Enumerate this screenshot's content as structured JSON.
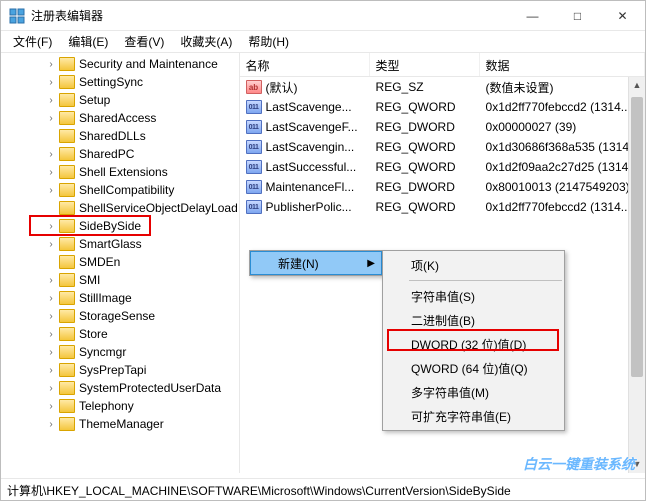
{
  "window": {
    "title": "注册表编辑器",
    "minimize": "—",
    "maximize": "□",
    "close": "✕"
  },
  "menubar": {
    "file": "文件(F)",
    "edit": "编辑(E)",
    "view": "查看(V)",
    "favorites": "收藏夹(A)",
    "help": "帮助(H)"
  },
  "tree": {
    "items": [
      {
        "label": "Security and Maintenance",
        "expandable": true
      },
      {
        "label": "SettingSync",
        "expandable": true
      },
      {
        "label": "Setup",
        "expandable": true
      },
      {
        "label": "SharedAccess",
        "expandable": true
      },
      {
        "label": "SharedDLLs",
        "expandable": false
      },
      {
        "label": "SharedPC",
        "expandable": true
      },
      {
        "label": "Shell Extensions",
        "expandable": true
      },
      {
        "label": "ShellCompatibility",
        "expandable": true
      },
      {
        "label": "ShellServiceObjectDelayLoad",
        "expandable": false
      },
      {
        "label": "SideBySide",
        "expandable": true,
        "highlight": true
      },
      {
        "label": "SmartGlass",
        "expandable": true
      },
      {
        "label": "SMDEn",
        "expandable": false
      },
      {
        "label": "SMI",
        "expandable": true
      },
      {
        "label": "StillImage",
        "expandable": true
      },
      {
        "label": "StorageSense",
        "expandable": true
      },
      {
        "label": "Store",
        "expandable": true
      },
      {
        "label": "Syncmgr",
        "expandable": true
      },
      {
        "label": "SysPrepTapi",
        "expandable": true
      },
      {
        "label": "SystemProtectedUserData",
        "expandable": true
      },
      {
        "label": "Telephony",
        "expandable": true
      },
      {
        "label": "ThemeManager",
        "expandable": true
      }
    ]
  },
  "list": {
    "cols": {
      "name": "名称",
      "type": "类型",
      "data": "数据"
    },
    "rows": [
      {
        "icon": "str",
        "name": "(默认)",
        "type": "REG_SZ",
        "data": "(数值未设置)"
      },
      {
        "icon": "bin",
        "name": "LastScavenge...",
        "type": "REG_QWORD",
        "data": "0x1d2ff770febccd2 (1314..."
      },
      {
        "icon": "bin",
        "name": "LastScavengeF...",
        "type": "REG_DWORD",
        "data": "0x00000027 (39)"
      },
      {
        "icon": "bin",
        "name": "LastScavengin...",
        "type": "REG_QWORD",
        "data": "0x1d30686f368a535 (1314..."
      },
      {
        "icon": "bin",
        "name": "LastSuccessful...",
        "type": "REG_QWORD",
        "data": "0x1d2f09aa2c27d25 (1314..."
      },
      {
        "icon": "bin",
        "name": "MaintenanceFl...",
        "type": "REG_DWORD",
        "data": "0x80010013 (2147549203)"
      },
      {
        "icon": "bin",
        "name": "PublisherPolic...",
        "type": "REG_QWORD",
        "data": "0x1d2ff770febccd2 (1314..."
      }
    ]
  },
  "context": {
    "new": "新建(N)",
    "submenu": {
      "key": "项(K)",
      "string": "字符串值(S)",
      "binary": "二进制值(B)",
      "dword": "DWORD (32 位)值(D)",
      "qword": "QWORD (64 位)值(Q)",
      "multi": "多字符串值(M)",
      "expand": "可扩充字符串值(E)"
    }
  },
  "statusbar": {
    "path": "计算机\\HKEY_LOCAL_MACHINE\\SOFTWARE\\Microsoft\\Windows\\CurrentVersion\\SideBySide"
  },
  "watermark": "白云一键重装系统"
}
